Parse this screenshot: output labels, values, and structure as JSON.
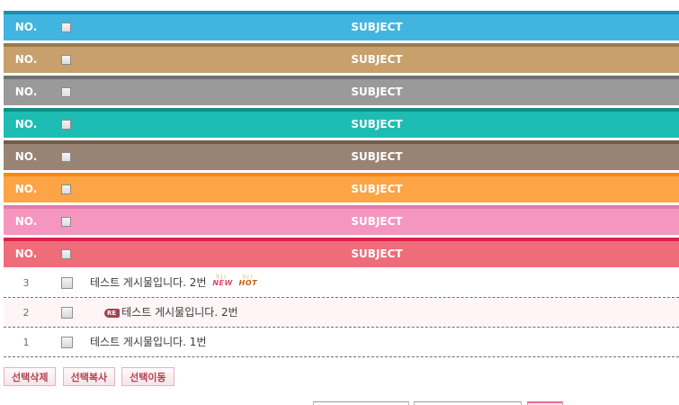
{
  "header_rows": [
    {
      "no_label": "NO.",
      "subject_label": "SUBJECT",
      "color": "#41b5df",
      "border_color": "#1a8eb8"
    },
    {
      "no_label": "NO.",
      "subject_label": "SUBJECT",
      "color": "#c7a06b",
      "border_color": "#9a7a4c"
    },
    {
      "no_label": "NO.",
      "subject_label": "SUBJECT",
      "color": "#9a9a9a",
      "border_color": "#707070"
    },
    {
      "no_label": "NO.",
      "subject_label": "SUBJECT",
      "color": "#1dbdb3",
      "border_color": "#0f8f88"
    },
    {
      "no_label": "NO.",
      "subject_label": "SUBJECT",
      "color": "#998473",
      "border_color": "#6e5c4d"
    },
    {
      "no_label": "NO.",
      "subject_label": "SUBJECT",
      "color": "#fda446",
      "border_color": "#f88a10"
    },
    {
      "no_label": "NO.",
      "subject_label": "SUBJECT",
      "color": "#f596c0",
      "border_color": "#e57aab"
    },
    {
      "no_label": "NO.",
      "subject_label": "SUBJECT",
      "color": "#ee6d78",
      "border_color": "#e0204d"
    }
  ],
  "posts": [
    {
      "no": "3",
      "title": "테스트 게시물입니다. 2번",
      "is_reply": false,
      "badges": [
        "NEW",
        "HOT"
      ]
    },
    {
      "no": "2",
      "title": "테스트 게시물입니다. 2번",
      "is_reply": true,
      "reply_badge": "RE",
      "badges": []
    },
    {
      "no": "1",
      "title": "테스트 게시물입니다. 1번",
      "is_reply": false,
      "badges": []
    }
  ],
  "actions": {
    "delete_label": "선택삭제",
    "copy_label": "선택복사",
    "move_label": "선택이동"
  },
  "icons": {
    "checkbox": "checkbox-icon",
    "reply": "reply-icon",
    "new_badge": "new-badge-icon",
    "hot_badge": "hot-badge-icon"
  }
}
